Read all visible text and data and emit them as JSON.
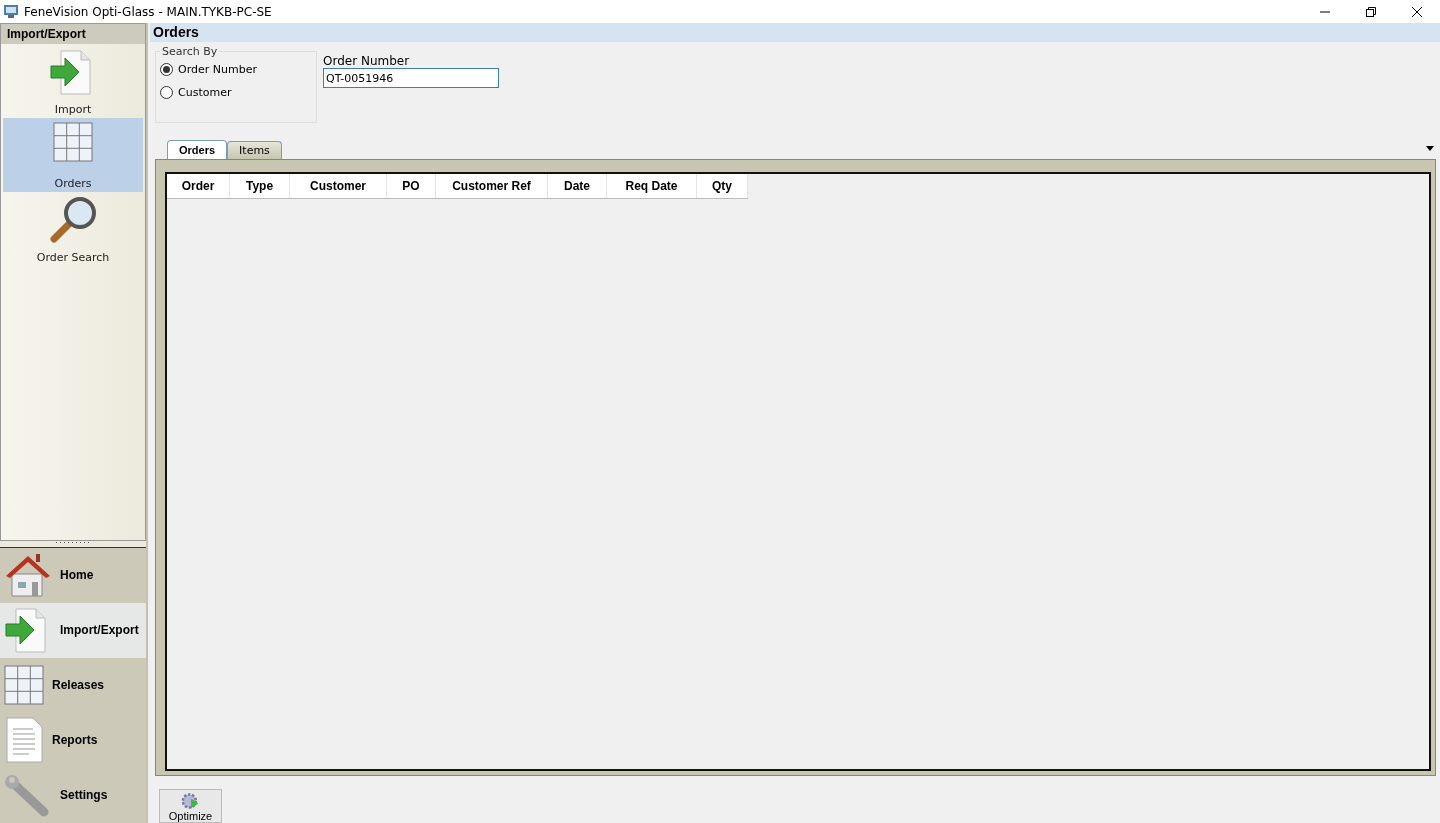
{
  "window": {
    "title": "FeneVision Opti-Glass - MAIN.TYKB-PC-SE"
  },
  "sidebar": {
    "header": "Import/Export",
    "items": [
      {
        "label": "Import",
        "selected": false
      },
      {
        "label": "Orders",
        "selected": true
      },
      {
        "label": "Order Search",
        "selected": false
      }
    ],
    "nav": [
      {
        "label": "Home",
        "selected": false
      },
      {
        "label": "Import/Export",
        "selected": true
      },
      {
        "label": "Releases",
        "selected": false
      },
      {
        "label": "Reports",
        "selected": false
      },
      {
        "label": "Settings",
        "selected": false
      }
    ]
  },
  "panel": {
    "title": "Orders",
    "search_by": {
      "legend": "Search By",
      "options": [
        {
          "label": "Order Number",
          "selected": true
        },
        {
          "label": "Customer",
          "selected": false
        }
      ]
    },
    "order_number": {
      "label": "Order Number",
      "value": "QT-0051946"
    },
    "tabs": [
      {
        "label": "Orders",
        "selected": true
      },
      {
        "label": "Items",
        "selected": false
      }
    ],
    "table": {
      "columns": [
        "Order",
        "Type",
        "Customer",
        "PO",
        "Customer Ref",
        "Date",
        "Req Date",
        "Qty"
      ]
    },
    "buttons": [
      {
        "label": "Optimize"
      }
    ]
  }
}
